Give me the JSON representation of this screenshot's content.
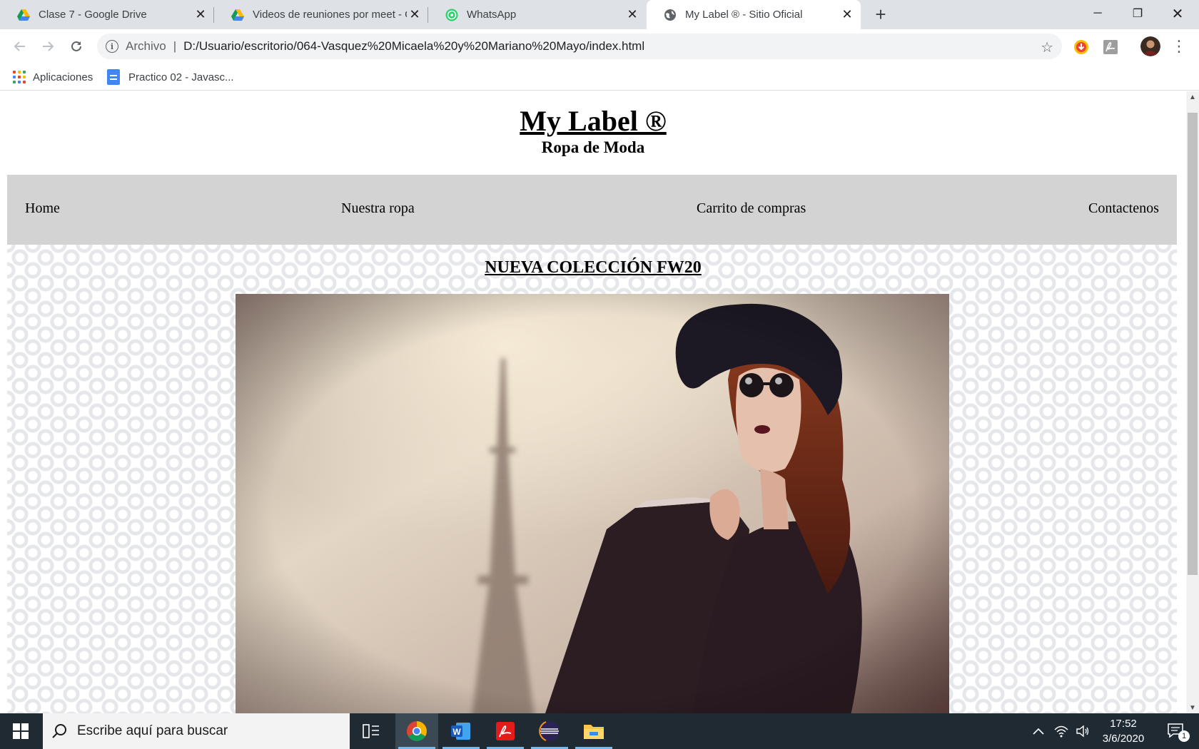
{
  "browser": {
    "tabs": [
      {
        "title": "Clase 7 - Google Drive",
        "icon": "google-drive-icon",
        "active": false
      },
      {
        "title": "Videos de reuniones por meet - G",
        "icon": "google-drive-icon",
        "active": false
      },
      {
        "title": "WhatsApp",
        "icon": "whatsapp-icon",
        "active": false
      },
      {
        "title": "My Label ® - Sitio Oficial",
        "icon": "globe-icon",
        "active": true
      }
    ],
    "address": {
      "scheme_label": "Archivo",
      "url": "D:/Usuario/escritorio/064-Vasquez%20Micaela%20y%20Mariano%20Mayo/index.html"
    },
    "bookmarks": [
      {
        "label": "Aplicaciones",
        "icon": "apps-grid-icon"
      },
      {
        "label": "Practico 02 - Javasc...",
        "icon": "google-docs-icon"
      }
    ]
  },
  "site": {
    "title": "My Label ®",
    "subtitle": "Ropa de Moda",
    "nav": [
      "Home",
      "Nuestra ropa",
      "Carrito de compras",
      "Contactenos"
    ],
    "section_heading": "NUEVA COLECCIÓN FW20",
    "colors": {
      "nav_bg": "#d3d3d3",
      "pattern": "#e6e7ea"
    }
  },
  "taskbar": {
    "search_placeholder": "Escribe aquí para buscar",
    "time": "17:52",
    "date": "3/6/2020",
    "notification_count": "1",
    "pinned": [
      "task-view-icon",
      "chrome-icon",
      "word-icon",
      "acrobat-icon",
      "eclipse-icon",
      "file-explorer-icon"
    ]
  }
}
